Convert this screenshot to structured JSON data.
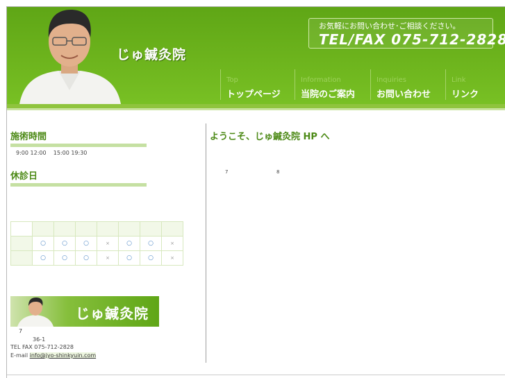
{
  "header": {
    "site_title": "じゅ鍼灸院",
    "contact_note": "お気軽にお問い合わせ･ご相談ください。",
    "contact_tel": "TEL/FAX  075-712-2828",
    "nav": [
      {
        "en": "Top",
        "ja": "トップページ"
      },
      {
        "en": "Information",
        "ja": "当院のご案内"
      },
      {
        "en": "Inquiries",
        "ja": "お問い合わせ"
      },
      {
        "en": "Link",
        "ja": "リンク"
      }
    ]
  },
  "sidebar": {
    "hours_heading": "施術時間",
    "hours_morning": "9:00 12:00",
    "hours_afternoon": "15:00 19:30",
    "closed_heading": "休診日",
    "schedule": {
      "row1": [
        "○",
        "○",
        "○",
        "×",
        "○",
        "○",
        "×"
      ],
      "row2": [
        "○",
        "○",
        "○",
        "×",
        "○",
        "○",
        "×"
      ]
    },
    "banner_title": "じゅ鍼灸院",
    "address": {
      "line1": "7",
      "line2": "36-1",
      "tel": "TEL FAX 075-712-2828",
      "email_label": "E-mail",
      "email": "info@jyo-shinkyuin.com"
    }
  },
  "main": {
    "title": "ようこそ、じゅ鍼灸院 HP へ",
    "num_a": "7",
    "num_b": "8"
  },
  "colors": {
    "header_green": "#6db41d",
    "heading_green": "#4d8a17",
    "accent_bar": "#c5e0a2"
  }
}
